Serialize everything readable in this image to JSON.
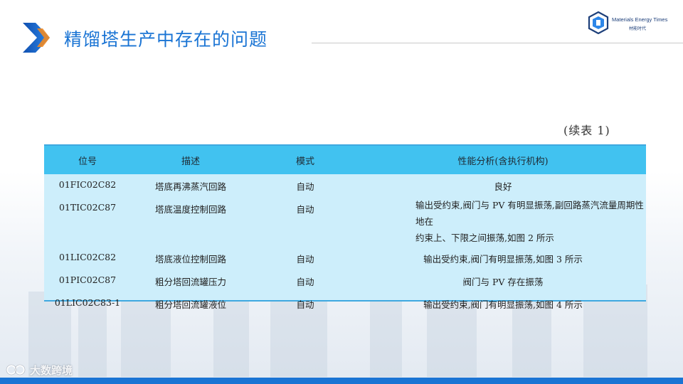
{
  "header": {
    "title": "精馏塔生产中存在的问题"
  },
  "logo": {
    "en": "Materials Energy Times",
    "cn": "材能时代"
  },
  "continuation_label": "(续表 1)",
  "table": {
    "columns": [
      "位号",
      "描述",
      "模式",
      "性能分析(含执行机构)"
    ],
    "rows": [
      {
        "tag": "01FIC02C82",
        "desc": "塔底再沸蒸汽回路",
        "mode": "自动",
        "analysis": [
          "良好"
        ]
      },
      {
        "tag": "01TIC02C87",
        "desc": "塔底温度控制回路",
        "mode": "自动",
        "analysis": [
          "输出受约束,阀门与 PV 有明显振荡,副回路蒸汽流量周期性地在",
          "约束上、下限之间振荡,如图 2 所示"
        ]
      },
      {
        "tag": "01LIC02C82",
        "desc": "塔底液位控制回路",
        "mode": "自动",
        "analysis": [
          "输出受约束,阀门有明显振荡,如图 3 所示"
        ]
      },
      {
        "tag": "01PIC02C87",
        "desc": "粗分塔回流罐压力",
        "mode": "自动",
        "analysis": [
          "阀门与 PV 存在振荡"
        ]
      },
      {
        "tag": "01LIC02C83-1",
        "desc": "粗分塔回流罐液位",
        "mode": "自动",
        "analysis": [
          "输出受约束,阀门有明显振荡,如图 4 所示"
        ]
      }
    ]
  },
  "watermark": {
    "text": "大数跨境"
  },
  "colors": {
    "accent": "#1a74d4",
    "table_header": "#41c2f0",
    "table_body": "#cdeefb"
  }
}
